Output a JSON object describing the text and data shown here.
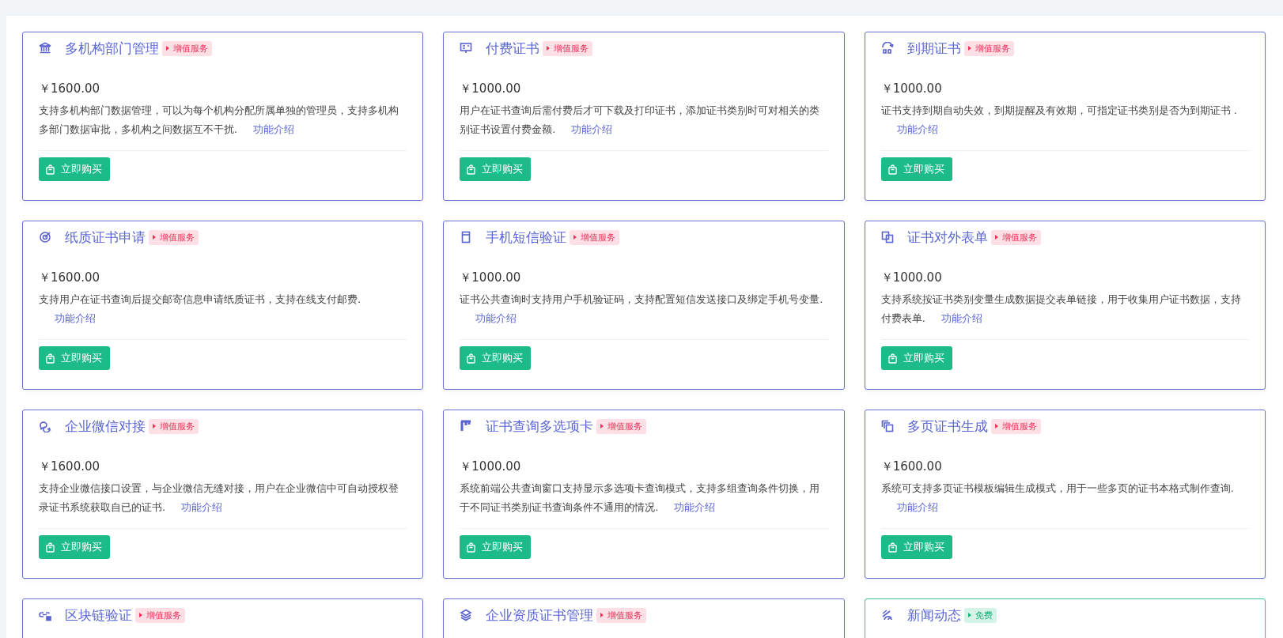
{
  "cards": [
    {
      "title": "多机构部门管理",
      "tag": {
        "kind": "paid",
        "label": "增值服务"
      },
      "price": "￥1600.00",
      "description": "支持多机构部门数据管理，可以为每个机构分配所属单独的管理员，支持多机构多部门数据审批，多机构之间数据互不干扰.",
      "link": "功能介绍",
      "button": "立即购买"
    },
    {
      "title": "付费证书",
      "tag": {
        "kind": "paid",
        "label": "增值服务"
      },
      "price": "￥1000.00",
      "description": "用户在证书查询后需付费后才可下载及打印证书，添加证书类别时可对相关的类别证书设置付费金额.",
      "link": "功能介绍",
      "button": "立即购买"
    },
    {
      "title": "到期证书",
      "tag": {
        "kind": "paid",
        "label": "增值服务"
      },
      "price": "￥1000.00",
      "description": "证书支持到期自动失效，到期提醒及有效期，可指定证书类别是否为到期证书 .",
      "link": "功能介绍",
      "button": "立即购买"
    },
    {
      "title": "纸质证书申请",
      "tag": {
        "kind": "paid",
        "label": "增值服务"
      },
      "price": "￥1600.00",
      "description": "支持用户在证书查询后提交邮寄信息申请纸质证书，支持在线支付邮费.",
      "link": "功能介绍",
      "button": "立即购买"
    },
    {
      "title": "手机短信验证",
      "tag": {
        "kind": "paid",
        "label": "增值服务"
      },
      "price": "￥1000.00",
      "description": "证书公共查询时支持用户手机验证码，支持配置短信发送接口及绑定手机号变量.",
      "link": "功能介绍",
      "button": "立即购买"
    },
    {
      "title": "证书对外表单",
      "tag": {
        "kind": "paid",
        "label": "增值服务"
      },
      "price": "￥1000.00",
      "description": "支持系统按证书类别变量生成数据提交表单链接，用于收集用户证书数据，支持付费表单.",
      "link": "功能介绍",
      "button": "立即购买"
    },
    {
      "title": "企业微信对接",
      "tag": {
        "kind": "paid",
        "label": "增值服务"
      },
      "price": "￥1600.00",
      "description": "支持企业微信接口设置，与企业微信无缝对接，用户在企业微信中可自动授权登录证书系统获取自已的证书.",
      "link": "功能介绍",
      "button": "立即购买"
    },
    {
      "title": "证书查询多选项卡",
      "tag": {
        "kind": "paid",
        "label": "增值服务"
      },
      "price": "￥1000.00",
      "description": "系统前端公共查询窗口支持显示多选项卡查询模式，支持多组查询条件切换，用于不同证书类别证书查询条件不通用的情况.",
      "link": "功能介绍",
      "button": "立即购买"
    },
    {
      "title": "多页证书生成",
      "tag": {
        "kind": "paid",
        "label": "增值服务"
      },
      "price": "￥1600.00",
      "description": "系统可支持多页证书模板编辑生成模式，用于一些多页的证书本格式制作查询.",
      "link": "功能介绍",
      "button": "立即购买"
    },
    {
      "title": "区块链验证",
      "tag": {
        "kind": "paid",
        "label": "增值服务"
      }
    },
    {
      "title": "企业资质证书管理",
      "tag": {
        "kind": "paid",
        "label": "增值服务"
      }
    },
    {
      "title": "新闻动态",
      "tag": {
        "kind": "free",
        "label": "免费"
      }
    }
  ]
}
